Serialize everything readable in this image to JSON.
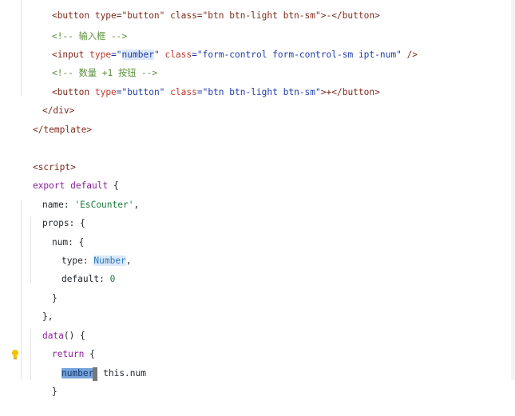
{
  "lines": {
    "l01": {
      "t1": "<button type=\"button\" class=\"btn btn-light btn-sm\">-</button>"
    },
    "l02": {
      "t1": "<!-- 输入框 -->"
    },
    "l03": {
      "p1": "<input ",
      "p2": "type",
      "p3": "=\"",
      "p4": "number",
      "p5": "\" ",
      "p6": "class",
      "p7": "=\"form-control form-control-sm ipt-num\"",
      "p8": " />"
    },
    "l04": {
      "t1": "<!-- 数量 +1 按钮 -->"
    },
    "l05": {
      "p1": "<button ",
      "p2": "type",
      "p3": "=\"button\" ",
      "p4": "class",
      "p5": "=\"btn btn-light btn-sm\"",
      "p6": ">+</button>"
    },
    "l06": {
      "t1": "</div>"
    },
    "l07": {
      "t1": "</template>"
    },
    "l08": {
      "t1": "<script>"
    },
    "l09": {
      "p1": "export default",
      "p2": " {"
    },
    "l10": {
      "p1": "name: ",
      "p2": "'EsCounter'",
      "p3": ","
    },
    "l11": {
      "t1": "props: {"
    },
    "l12": {
      "t1": "num: {"
    },
    "l13": {
      "p1": "type: ",
      "p2": "Number",
      "p3": ","
    },
    "l14": {
      "p1": "default: ",
      "p2": "0"
    },
    "l15": {
      "t1": "}"
    },
    "l16": {
      "t1": "},"
    },
    "l17": {
      "p1": "data",
      "p2": "() {"
    },
    "l18": {
      "p1": "return",
      "p2": " {"
    },
    "l19": {
      "p1": "number",
      "p2": " this.num"
    },
    "l20": {
      "t1": "}"
    }
  },
  "colors": {
    "tag": "#7d2a1e",
    "attribute": "#c0392b",
    "string": "#1f3ba8",
    "comment": "#5a8f3c",
    "keyword": "#8a1f9a",
    "type": "#2b7bbb",
    "selection": "#78a6dc",
    "highlight": "#dce9fb",
    "bulb": "#f2c200"
  },
  "icons": {
    "gutter": "lightbulb-icon"
  }
}
